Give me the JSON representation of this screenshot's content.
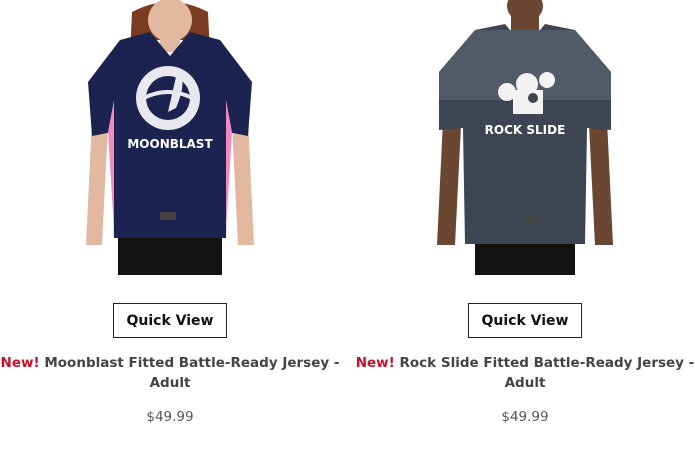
{
  "products": [
    {
      "image_alt": "Moonblast jersey",
      "graphic_text": "MOONBLAST",
      "quick_view_label": "Quick View",
      "badge": "New!",
      "name": "Moonblast Fitted Battle-Ready Jersey - Adult",
      "price": "$49.99",
      "colors": {
        "jersey": "#1d2350",
        "accent": "#f08bbf"
      }
    },
    {
      "image_alt": "Rock Slide jersey",
      "graphic_text": "ROCK SLIDE",
      "quick_view_label": "Quick View",
      "badge": "New!",
      "name": "Rock Slide Fitted Battle-Ready Jersey - Adult",
      "price": "$49.99",
      "colors": {
        "jersey": "#3d4452",
        "accent": "#ffffff"
      }
    }
  ],
  "colors": {
    "badge": "#c8102e"
  }
}
